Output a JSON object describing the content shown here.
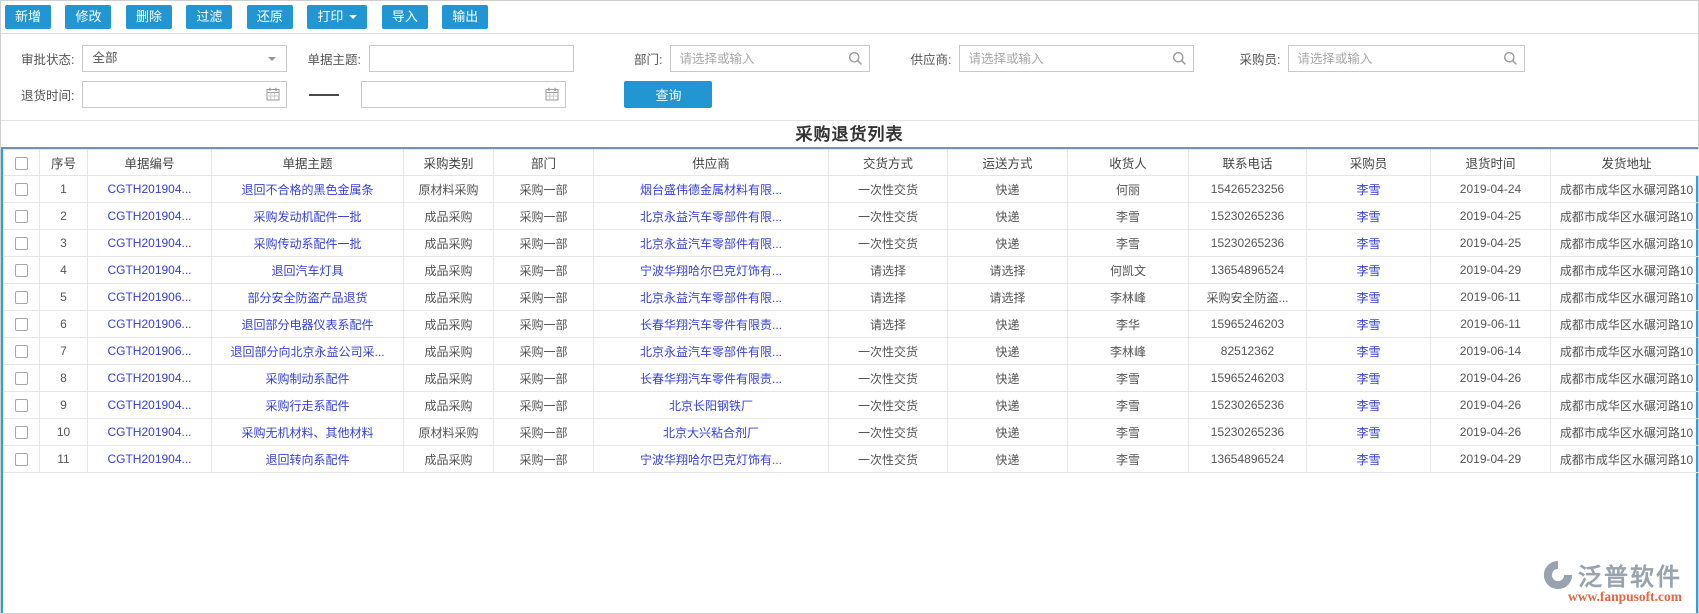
{
  "toolbar": {
    "buttons": [
      {
        "label": "新增"
      },
      {
        "label": "修改"
      },
      {
        "label": "删除"
      },
      {
        "label": "过滤"
      },
      {
        "label": "还原"
      },
      {
        "label": "打印",
        "caret": true
      },
      {
        "label": "导入"
      },
      {
        "label": "输出"
      }
    ]
  },
  "filters": {
    "approval_status": {
      "label": "审批状态:",
      "value": "全部"
    },
    "subject": {
      "label": "单据主题:",
      "value": ""
    },
    "department": {
      "label": "部门:",
      "placeholder": "请选择或输入",
      "value": ""
    },
    "supplier": {
      "label": "供应商:",
      "placeholder": "请选择或输入",
      "value": ""
    },
    "purchaser": {
      "label": "采购员:",
      "placeholder": "请选择或输入",
      "value": ""
    },
    "return_time": {
      "label": "退货时间:",
      "from_value": "",
      "to_value": ""
    },
    "query_button": "查询"
  },
  "list": {
    "title": "采购退货列表",
    "columns": [
      "序号",
      "单据编号",
      "单据主题",
      "采购类别",
      "部门",
      "供应商",
      "交货方式",
      "运送方式",
      "收货人",
      "联系电话",
      "采购员",
      "退货时间",
      "发货地址"
    ],
    "rows": [
      {
        "seq": "1",
        "doc_no": "CGTH201904...",
        "subject": "退回不合格的黑色金属条",
        "category": "原材料采购",
        "department": "采购一部",
        "supplier": "烟台盛伟德金属材料有限...",
        "delivery": "一次性交货",
        "shipping": "快递",
        "receiver": "何丽",
        "phone": "15426523256",
        "purchaser": "李雪",
        "return_date": "2019-04-24",
        "address": "成都市成华区水碾河路10"
      },
      {
        "seq": "2",
        "doc_no": "CGTH201904...",
        "subject": "采购发动机配件一批",
        "category": "成品采购",
        "department": "采购一部",
        "supplier": "北京永益汽车零部件有限...",
        "delivery": "一次性交货",
        "shipping": "快递",
        "receiver": "李雪",
        "phone": "15230265236",
        "purchaser": "李雪",
        "return_date": "2019-04-25",
        "address": "成都市成华区水碾河路10"
      },
      {
        "seq": "3",
        "doc_no": "CGTH201904...",
        "subject": "采购传动系配件一批",
        "category": "成品采购",
        "department": "采购一部",
        "supplier": "北京永益汽车零部件有限...",
        "delivery": "一次性交货",
        "shipping": "快递",
        "receiver": "李雪",
        "phone": "15230265236",
        "purchaser": "李雪",
        "return_date": "2019-04-25",
        "address": "成都市成华区水碾河路10"
      },
      {
        "seq": "4",
        "doc_no": "CGTH201904...",
        "subject": "退回汽车灯具",
        "category": "成品采购",
        "department": "采购一部",
        "supplier": "宁波华翔哈尔巴克灯饰有...",
        "delivery": "请选择",
        "shipping": "请选择",
        "receiver": "何凯文",
        "phone": "13654896524",
        "purchaser": "李雪",
        "return_date": "2019-04-29",
        "address": "成都市成华区水碾河路10"
      },
      {
        "seq": "5",
        "doc_no": "CGTH201906...",
        "subject": "部分安全防盗产品退货",
        "category": "成品采购",
        "department": "采购一部",
        "supplier": "北京永益汽车零部件有限...",
        "delivery": "请选择",
        "shipping": "请选择",
        "receiver": "李林峰",
        "phone": "采购安全防盗...",
        "purchaser": "李雪",
        "return_date": "2019-06-11",
        "address": "成都市成华区水碾河路10"
      },
      {
        "seq": "6",
        "doc_no": "CGTH201906...",
        "subject": "退回部分电器仪表系配件",
        "category": "成品采购",
        "department": "采购一部",
        "supplier": "长春华翔汽车零件有限责...",
        "delivery": "请选择",
        "shipping": "快递",
        "receiver": "李华",
        "phone": "15965246203",
        "purchaser": "李雪",
        "return_date": "2019-06-11",
        "address": "成都市成华区水碾河路10"
      },
      {
        "seq": "7",
        "doc_no": "CGTH201906...",
        "subject": "退回部分向北京永益公司采...",
        "category": "成品采购",
        "department": "采购一部",
        "supplier": "北京永益汽车零部件有限...",
        "delivery": "一次性交货",
        "shipping": "快递",
        "receiver": "李林峰",
        "phone": "82512362",
        "purchaser": "李雪",
        "return_date": "2019-06-14",
        "address": "成都市成华区水碾河路10"
      },
      {
        "seq": "8",
        "doc_no": "CGTH201904...",
        "subject": "采购制动系配件",
        "category": "成品采购",
        "department": "采购一部",
        "supplier": "长春华翔汽车零件有限责...",
        "delivery": "一次性交货",
        "shipping": "快递",
        "receiver": "李雪",
        "phone": "15965246203",
        "purchaser": "李雪",
        "return_date": "2019-04-26",
        "address": "成都市成华区水碾河路10"
      },
      {
        "seq": "9",
        "doc_no": "CGTH201904...",
        "subject": "采购行走系配件",
        "category": "成品采购",
        "department": "采购一部",
        "supplier": "北京长阳钢铁厂",
        "delivery": "一次性交货",
        "shipping": "快递",
        "receiver": "李雪",
        "phone": "15230265236",
        "purchaser": "李雪",
        "return_date": "2019-04-26",
        "address": "成都市成华区水碾河路10"
      },
      {
        "seq": "10",
        "doc_no": "CGTH201904...",
        "subject": "采购无机材料、其他材料",
        "category": "原材料采购",
        "department": "采购一部",
        "supplier": "北京大兴粘合剂厂",
        "delivery": "一次性交货",
        "shipping": "快递",
        "receiver": "李雪",
        "phone": "15230265236",
        "purchaser": "李雪",
        "return_date": "2019-04-26",
        "address": "成都市成华区水碾河路10"
      },
      {
        "seq": "11",
        "doc_no": "CGTH201904...",
        "subject": "退回转向系配件",
        "category": "成品采购",
        "department": "采购一部",
        "supplier": "宁波华翔哈尔巴克灯饰有...",
        "delivery": "一次性交货",
        "shipping": "快递",
        "receiver": "李雪",
        "phone": "13654896524",
        "purchaser": "李雪",
        "return_date": "2019-04-29",
        "address": "成都市成华区水碾河路10"
      }
    ]
  },
  "watermark": {
    "name": "泛普软件",
    "url": "www.fanpusoft.com"
  },
  "colors": {
    "accent": "#2196d3",
    "link": "#3540dd",
    "panel_border_blue": "#2d9fe2",
    "header_top_border": "#7093b3"
  }
}
